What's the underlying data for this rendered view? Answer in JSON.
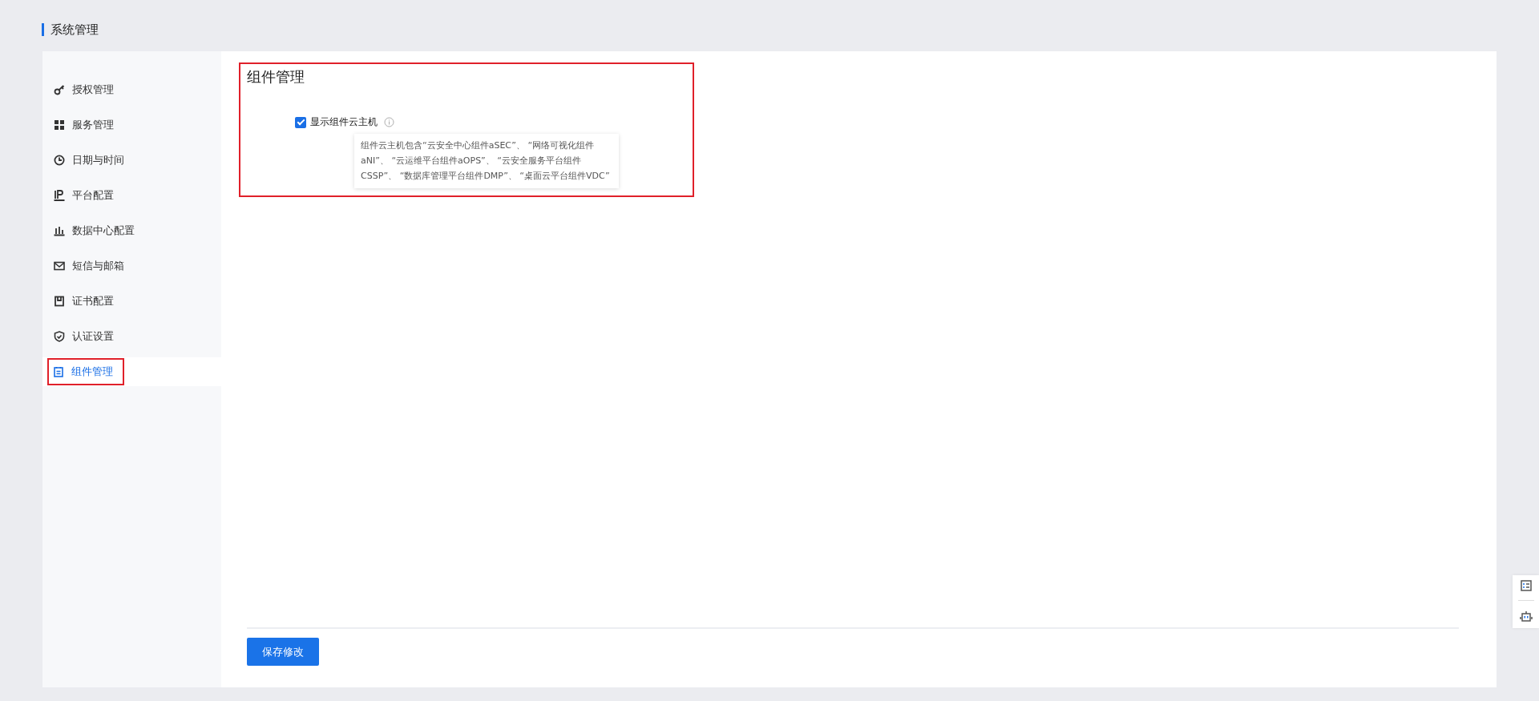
{
  "header": {
    "title": "系统管理"
  },
  "sidebar": {
    "items": [
      {
        "label": "授权管理",
        "selected": false
      },
      {
        "label": "服务管理",
        "selected": false
      },
      {
        "label": "日期与时间",
        "selected": false
      },
      {
        "label": "平台配置",
        "selected": false
      },
      {
        "label": "数据中心配置",
        "selected": false
      },
      {
        "label": "短信与邮箱",
        "selected": false
      },
      {
        "label": "证书配置",
        "selected": false
      },
      {
        "label": "认证设置",
        "selected": false
      },
      {
        "label": "组件管理",
        "selected": true
      }
    ]
  },
  "content": {
    "title": "组件管理",
    "option": {
      "label": "显示组件云主机",
      "checked": true
    },
    "tooltip": "组件云主机包含“云安全中心组件aSEC”、 “网络可视化组件aNI”、 “云运维平台组件aOPS”、 “云安全服务平台组件CSSP”、 “数据库管理平台组件DMP”、 “桌面云平台组件VDC”",
    "save_button": "保存修改"
  }
}
